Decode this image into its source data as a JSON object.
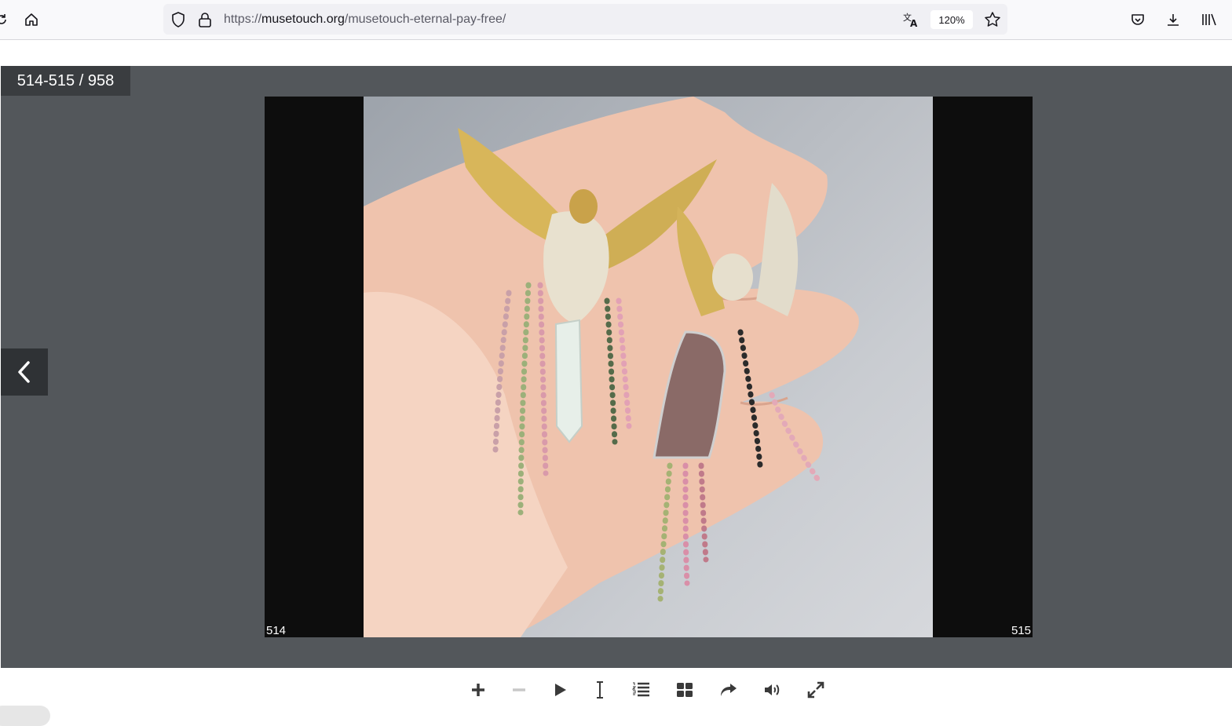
{
  "browser": {
    "url_prefix": "https://",
    "url_domain": "musetouch.org",
    "url_path": "/musetouch-eternal-pay-free/",
    "zoom": "120%"
  },
  "viewer": {
    "counter": "514-515 / 958",
    "left_page_number": "514",
    "right_page_number": "515"
  },
  "controls": [
    {
      "name": "zoom-in-icon"
    },
    {
      "name": "zoom-out-icon"
    },
    {
      "name": "play-icon"
    },
    {
      "name": "text-select-icon"
    },
    {
      "name": "table-of-contents-icon"
    },
    {
      "name": "thumbnails-icon"
    },
    {
      "name": "share-icon"
    },
    {
      "name": "sound-icon"
    },
    {
      "name": "fullscreen-icon"
    }
  ],
  "colors": {
    "viewer_bg": "#53575b",
    "spread_bg": "#0d0d0d",
    "icon": "#3a3a3a"
  }
}
